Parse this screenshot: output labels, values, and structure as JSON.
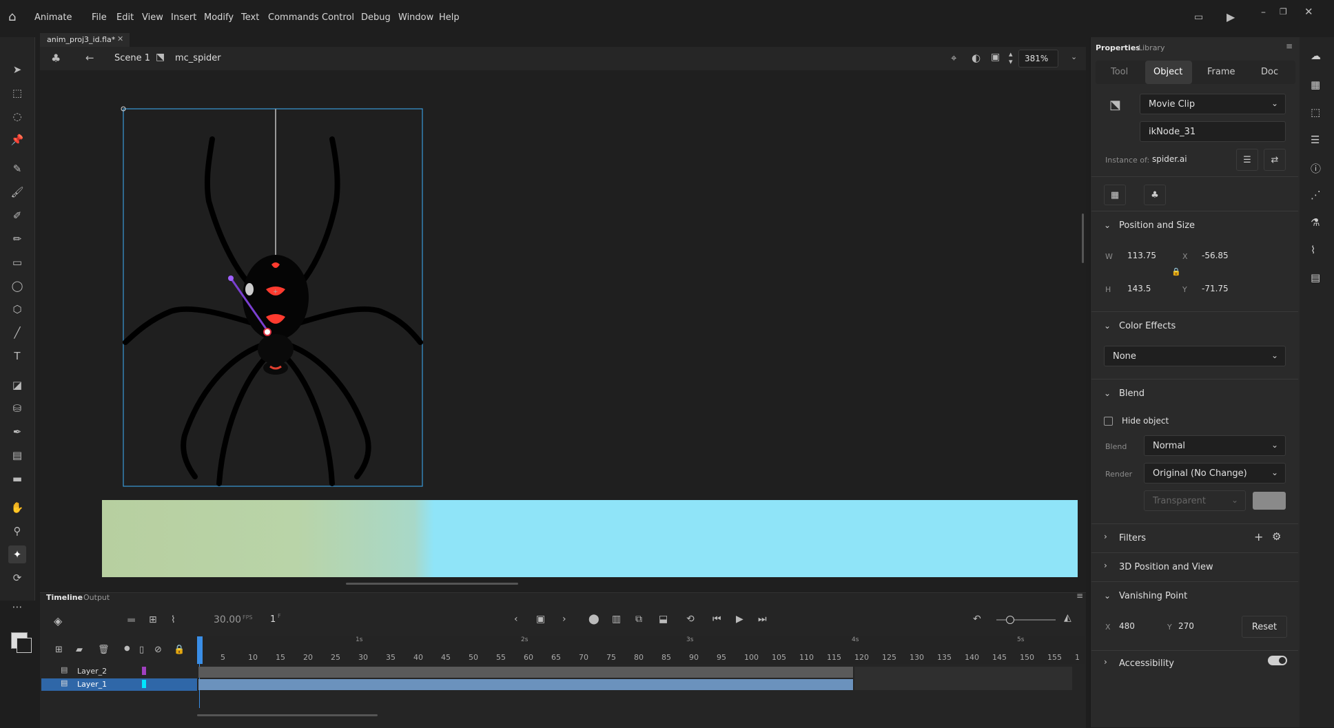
{
  "app": {
    "name": "Animate"
  },
  "menu": [
    "File",
    "Edit",
    "View",
    "Insert",
    "Modify",
    "Text",
    "Commands",
    "Control",
    "Debug",
    "Window",
    "Help"
  ],
  "document_tab": {
    "label": "anim_proj3_id.fla*"
  },
  "edit_bar": {
    "scene": "Scene 1",
    "symbol": "mc_spider",
    "zoom": "381%"
  },
  "properties": {
    "tabs": {
      "properties": "Properties",
      "library": "Library"
    },
    "mode_tabs": [
      "Tool",
      "Object",
      "Frame",
      "Doc"
    ],
    "active_mode": "Object",
    "symbol_type": "Movie Clip",
    "instance_name": "ikNode_31",
    "instance_of_label": "Instance of:",
    "instance_of_value": "spider.ai",
    "position_size": {
      "title": "Position and Size",
      "w_label": "W",
      "w": "113.75",
      "x_label": "X",
      "x": "-56.85",
      "h_label": "H",
      "h": "143.5",
      "y_label": "Y",
      "y": "-71.75"
    },
    "color_effects": {
      "title": "Color Effects",
      "value": "None"
    },
    "blend": {
      "title": "Blend",
      "hide_object": "Hide object",
      "blend_label": "Blend",
      "blend_value": "Normal",
      "render_label": "Render",
      "render_value": "Original (No Change)",
      "transparent": "Transparent"
    },
    "filters": "Filters",
    "three_d": "3D Position and View",
    "vanishing_point": {
      "title": "Vanishing Point",
      "x_label": "X",
      "x": "480",
      "y_label": "Y",
      "y": "270",
      "reset": "Reset"
    },
    "accessibility": "Accessibility"
  },
  "timeline": {
    "tabs": [
      "Timeline",
      "Output"
    ],
    "fps": "30.00",
    "fps_unit": "FPS",
    "frame": "1",
    "frame_unit": "F",
    "seconds": [
      "1s",
      "2s",
      "3s",
      "4s",
      "5s"
    ],
    "frame_ticks": [
      "5",
      "10",
      "15",
      "20",
      "25",
      "30",
      "35",
      "40",
      "45",
      "50",
      "55",
      "60",
      "65",
      "70",
      "75",
      "80",
      "85",
      "90",
      "95",
      "100",
      "105",
      "110",
      "115",
      "120",
      "125",
      "130",
      "135",
      "140",
      "145",
      "150",
      "155",
      "1"
    ],
    "layers": [
      {
        "name": "Layer_2",
        "color": "#a040c0"
      },
      {
        "name": "Layer_1",
        "color": "#00e5ff"
      }
    ]
  }
}
